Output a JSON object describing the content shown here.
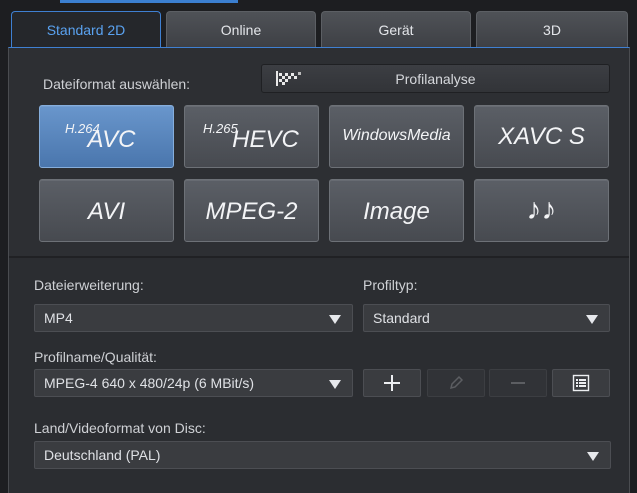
{
  "tabs": [
    {
      "label": "Standard 2D",
      "active": true
    },
    {
      "label": "Online",
      "active": false
    },
    {
      "label": "Gerät",
      "active": false
    },
    {
      "label": "3D",
      "active": false
    }
  ],
  "format_section": {
    "label": "Dateiformat auswählen:",
    "profile_analysis_button": "Profilanalyse",
    "formats": [
      {
        "label": "AVC",
        "superscript": "H.264",
        "active": true
      },
      {
        "label": "HEVC",
        "superscript": "H.265",
        "active": false
      },
      {
        "label": "WindowsMedia",
        "active": false
      },
      {
        "label": "XAVC S",
        "active": false
      },
      {
        "label": "AVI",
        "active": false
      },
      {
        "label": "MPEG-2",
        "active": false
      },
      {
        "label": "Image",
        "active": false
      },
      {
        "label": "♪♪",
        "icon": "music-notes-icon",
        "active": false
      }
    ]
  },
  "extension": {
    "label": "Dateierweiterung:",
    "value": "MP4"
  },
  "profile_type": {
    "label": "Profiltyp:",
    "value": "Standard"
  },
  "profile_quality": {
    "label": "Profilname/Qualität:",
    "value": "MPEG-4 640 x 480/24p (6 MBit/s)"
  },
  "tools": [
    {
      "icon": "plus-icon",
      "enabled": true
    },
    {
      "icon": "pencil-icon",
      "enabled": false
    },
    {
      "icon": "minus-icon",
      "enabled": false
    },
    {
      "icon": "list-icon",
      "enabled": true
    }
  ],
  "disc_format": {
    "label": "Land/Videoformat von Disc:",
    "value": "Deutschland (PAL)"
  },
  "colors": {
    "accent": "#3f80d2",
    "active_tab_text": "#5aa2f0",
    "active_format": "#5a86bd",
    "panel": "#2c2e32"
  }
}
